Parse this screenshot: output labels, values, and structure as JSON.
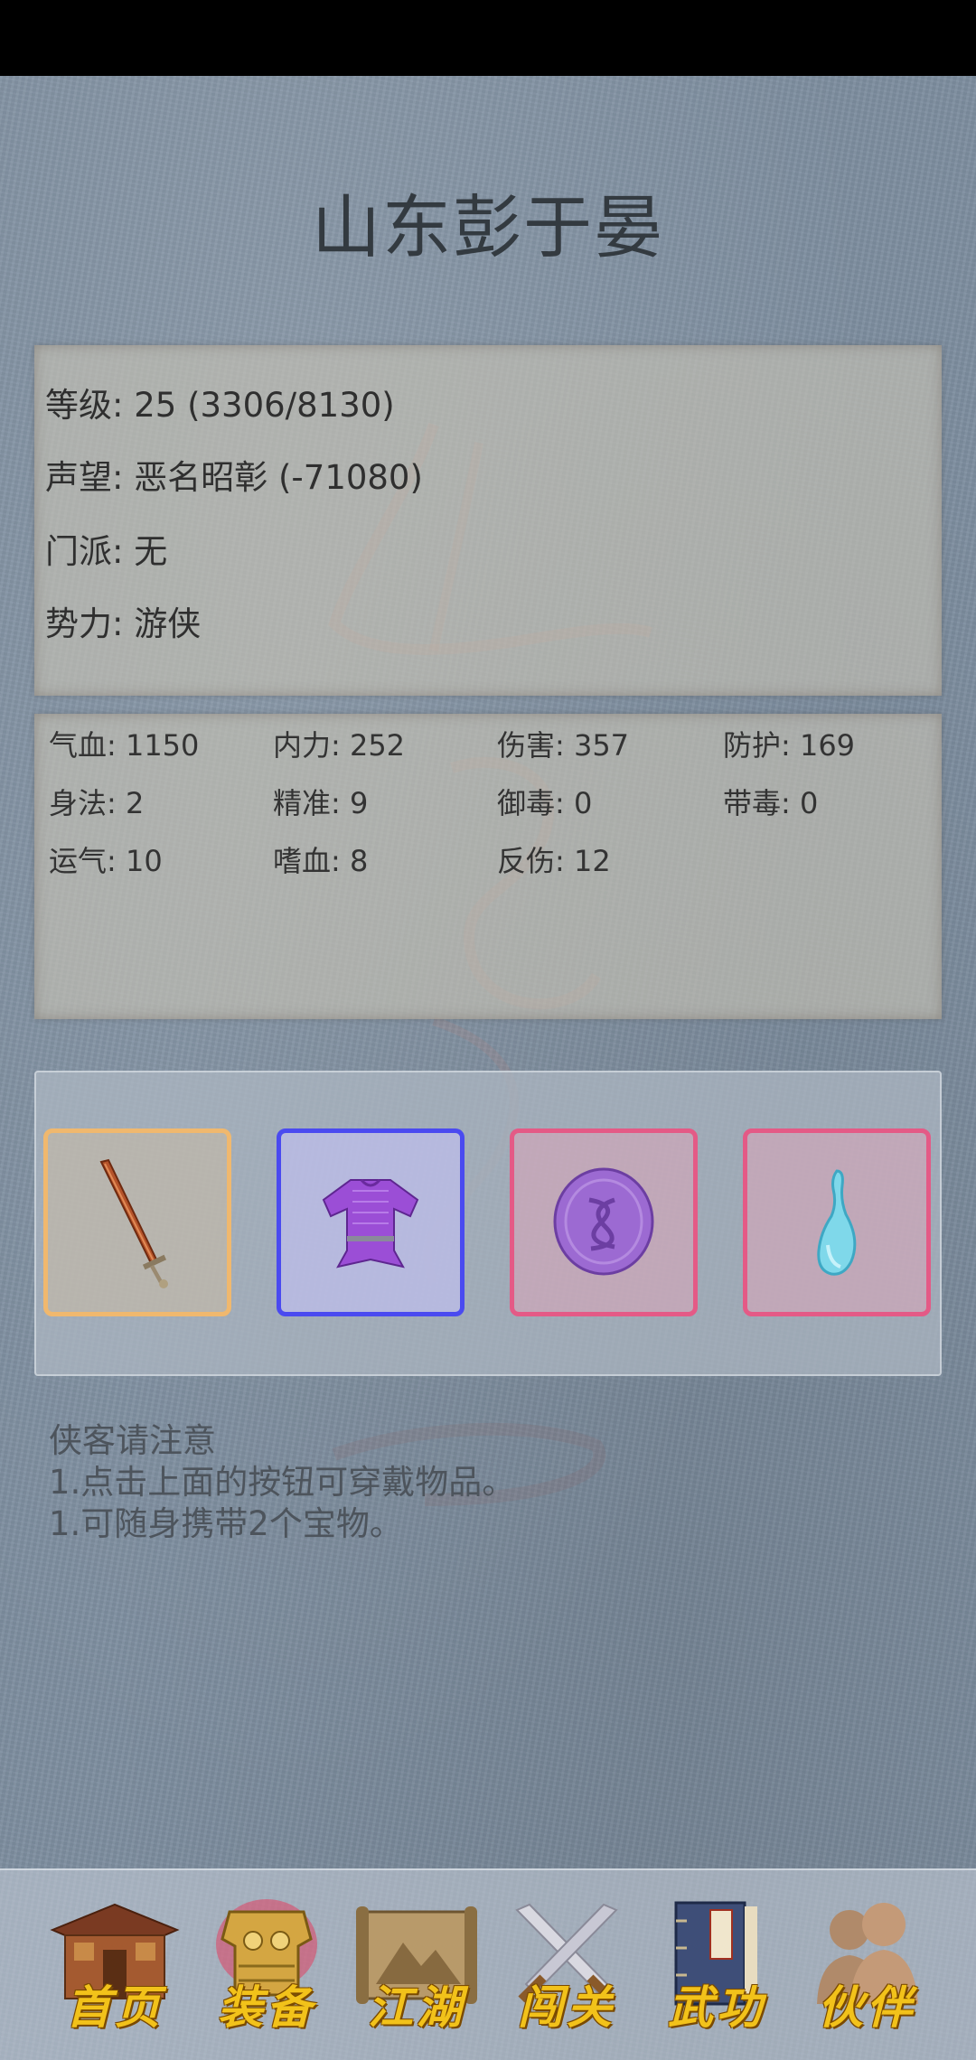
{
  "player": {
    "name": "山东彭于晏"
  },
  "info": {
    "level": "等级: 25 (3306/8130)",
    "reputation": "声望: 恶名昭彰 (-71080)",
    "sect": "门派: 无",
    "faction": "势力:  游侠"
  },
  "stats": [
    [
      "气血: 1150",
      "内力: 252",
      "伤害: 357",
      "防护: 169"
    ],
    [
      "身法: 2",
      "精准: 9",
      "御毒: 0",
      "带毒: 0"
    ],
    [
      "运气: 10",
      "嗜血: 8",
      "反伤: 12",
      ""
    ]
  ],
  "equipment": [
    {
      "slot": "weapon",
      "icon": "sword-icon",
      "border_color": "#f0b86e"
    },
    {
      "slot": "armor",
      "icon": "purple-armor-icon",
      "border_color": "#4a4af0"
    },
    {
      "slot": "treasure-1",
      "icon": "purple-jade-icon",
      "border_color": "#e45a86"
    },
    {
      "slot": "treasure-2",
      "icon": "blue-gourd-icon",
      "border_color": "#e45a86"
    }
  ],
  "notice": {
    "title": "侠客请注意",
    "line1": "1.点击上面的按钮可穿戴物品。",
    "line2": "1.可随身携带2个宝物。"
  },
  "nav": [
    {
      "label": "首页",
      "icon": "house-icon"
    },
    {
      "label": "装备",
      "icon": "armor-icon"
    },
    {
      "label": "江湖",
      "icon": "scroll-map-icon"
    },
    {
      "label": "闯关",
      "icon": "crossed-swords-icon"
    },
    {
      "label": "武功",
      "icon": "book-icon"
    },
    {
      "label": "伙伴",
      "icon": "companions-icon"
    }
  ]
}
